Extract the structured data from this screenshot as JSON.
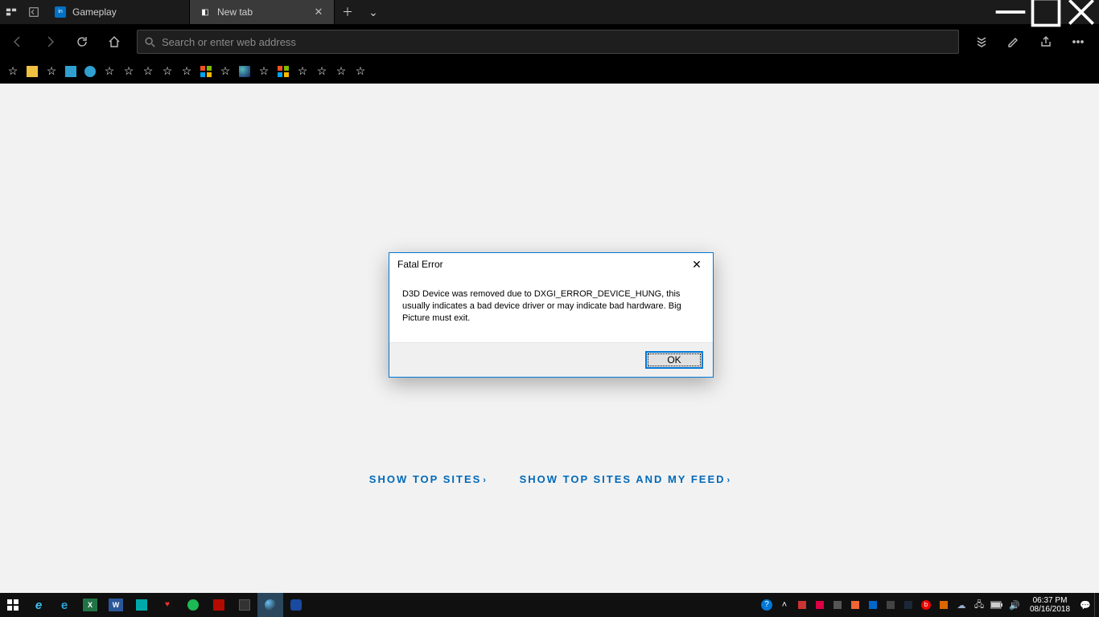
{
  "browser": {
    "tabs": [
      {
        "label": "Gameplay",
        "active": false,
        "favicon": "intel-icon"
      },
      {
        "label": "New tab",
        "active": true,
        "favicon": "edge-icon"
      }
    ],
    "addressbar": {
      "placeholder": "Search or enter web address"
    },
    "newtab": {
      "link1": "SHOW TOP SITES",
      "link2": "SHOW TOP SITES AND MY FEED"
    }
  },
  "dialog": {
    "title": "Fatal Error",
    "body": "D3D Device was removed due to DXGI_ERROR_DEVICE_HUNG, this usually indicates a bad device driver or may indicate bad hardware. Big Picture must exit.",
    "ok_label": "OK"
  },
  "taskbar": {
    "time": "06:37 PM",
    "date": "08/16/2018"
  },
  "favorites_count": 19
}
